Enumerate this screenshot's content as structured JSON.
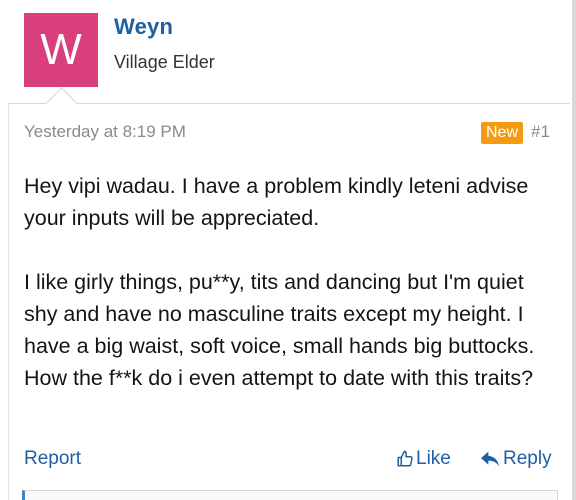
{
  "author": {
    "avatar_letter": "W",
    "avatar_color": "#d93f7d",
    "name": "Weyn",
    "title": "Village Elder"
  },
  "post": {
    "timestamp": "Yesterday at 8:19 PM",
    "badge": "New",
    "number": "#1",
    "paragraphs": [
      "Hey vipi wadau. I have a problem kindly leteni advise your inputs will be appreciated.",
      "I like girly things, pu**y, tits and dancing but I'm quiet shy and have no masculine traits except my height. I have a big waist, soft voice, small hands big buttocks. How the f**k do i even attempt to date with this traits?"
    ]
  },
  "actions": {
    "report": "Report",
    "like": "Like",
    "like_icon": "thumbs-up-icon",
    "reply": "Reply",
    "reply_icon": "reply-arrow-icon"
  },
  "colors": {
    "link": "#1f5fa3",
    "badge": "#f39c12",
    "meta": "#8a8a8a"
  }
}
